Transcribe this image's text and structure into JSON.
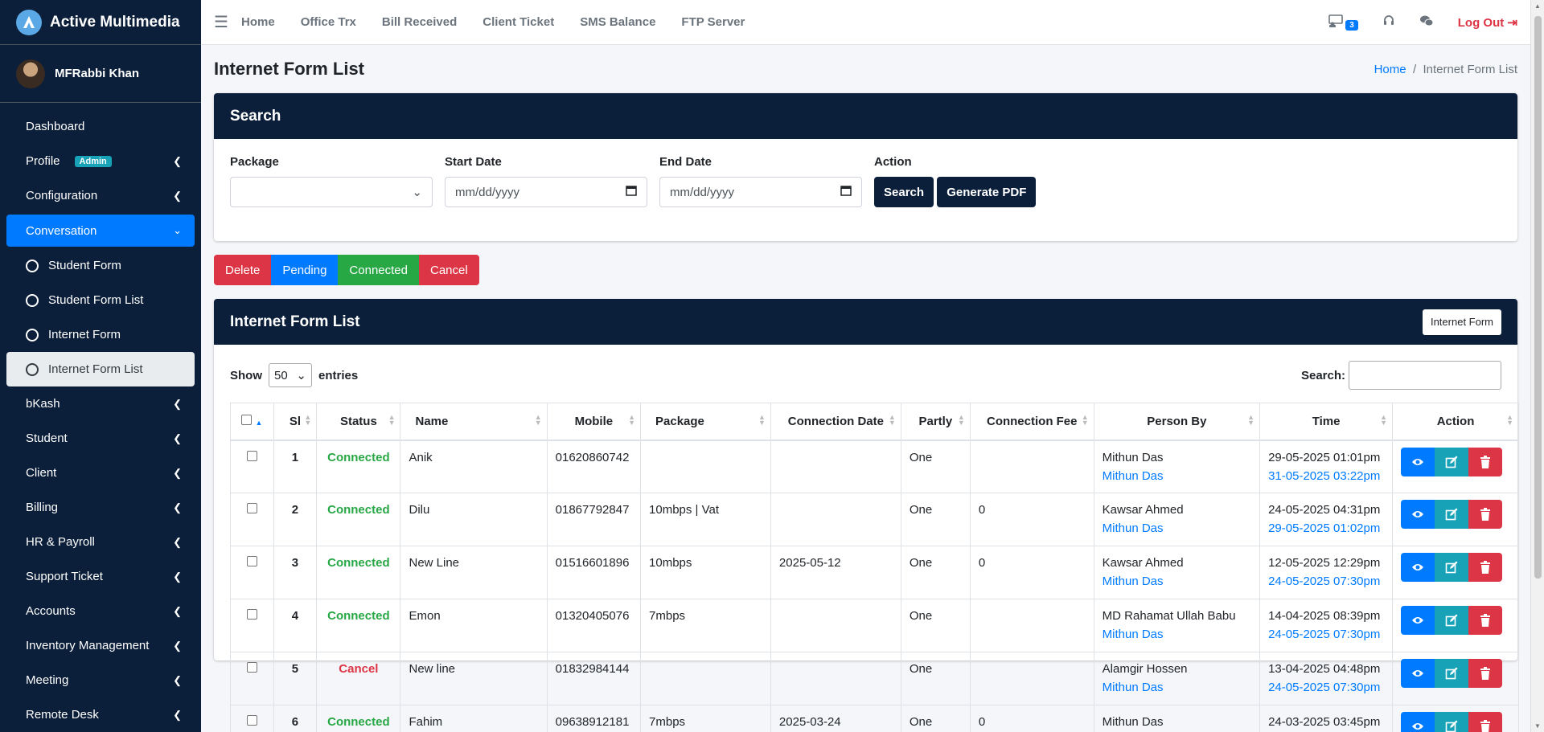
{
  "brand": {
    "name": "Active Multimedia"
  },
  "user": {
    "name": "MFRabbi Khan"
  },
  "sidebar": {
    "items": [
      {
        "label": "Dashboard"
      },
      {
        "label": "Profile",
        "badge": "Admin"
      },
      {
        "label": "Configuration"
      },
      {
        "label": "Conversation"
      },
      {
        "label": "Student Form"
      },
      {
        "label": "Student Form List"
      },
      {
        "label": "Internet Form"
      },
      {
        "label": "Internet Form List"
      },
      {
        "label": "bKash"
      },
      {
        "label": "Student"
      },
      {
        "label": "Client"
      },
      {
        "label": "Billing"
      },
      {
        "label": "HR & Payroll"
      },
      {
        "label": "Support Ticket"
      },
      {
        "label": "Accounts"
      },
      {
        "label": "Inventory Management"
      },
      {
        "label": "Meeting"
      },
      {
        "label": "Remote Desk"
      }
    ]
  },
  "topnav": {
    "links": [
      "Home",
      "Office Trx",
      "Bill Received",
      "Client Ticket",
      "SMS Balance",
      "FTP Server"
    ],
    "notification_count": "3",
    "logout": "Log Out"
  },
  "page": {
    "title": "Internet Form List",
    "breadcrumb_home": "Home",
    "breadcrumb_sep": "/",
    "breadcrumb_current": "Internet Form List"
  },
  "search": {
    "header": "Search",
    "package_label": "Package",
    "start_date_label": "Start Date",
    "start_date_placeholder": "mm/dd/yyyy",
    "end_date_label": "End Date",
    "end_date_placeholder": "mm/dd/yyyy",
    "action_label": "Action",
    "search_button": "Search",
    "pdf_button": "Generate PDF"
  },
  "status_buttons": {
    "delete": "Delete",
    "pending": "Pending",
    "connected": "Connected",
    "cancel": "Cancel"
  },
  "list": {
    "header": "Internet Form List",
    "internet_form_button": "Internet Form",
    "show": "Show",
    "entries_value": "50",
    "entries": "entries",
    "search_label": "Search:",
    "columns": [
      "Sl",
      "Status",
      "Name",
      "Mobile",
      "Package",
      "Connection Date",
      "Partly",
      "Connection Fee",
      "Person By",
      "Time",
      "Action"
    ],
    "rows": [
      {
        "sl": "1",
        "status": "Connected",
        "name": "Anik",
        "mobile": "01620860742",
        "package": "",
        "conn_date": "",
        "partly": "One",
        "fee": "",
        "person": "Mithun Das",
        "person2": "Mithun Das",
        "time": "29-05-2025 01:01pm",
        "time2": "31-05-2025 03:22pm"
      },
      {
        "sl": "2",
        "status": "Connected",
        "name": "Dilu",
        "mobile": "01867792847",
        "package": "10mbps | Vat",
        "conn_date": "",
        "partly": "One",
        "fee": "0",
        "person": "Kawsar Ahmed",
        "person2": "Mithun Das",
        "time": "24-05-2025 04:31pm",
        "time2": "29-05-2025 01:02pm"
      },
      {
        "sl": "3",
        "status": "Connected",
        "name": "New Line",
        "mobile": "01516601896",
        "package": "10mbps",
        "conn_date": "2025-05-12",
        "partly": "One",
        "fee": "0",
        "person": "Kawsar Ahmed",
        "person2": "Mithun Das",
        "time": "12-05-2025 12:29pm",
        "time2": "24-05-2025 07:30pm"
      },
      {
        "sl": "4",
        "status": "Connected",
        "name": "Emon",
        "mobile": "01320405076",
        "package": "7mbps",
        "conn_date": "",
        "partly": "One",
        "fee": "",
        "person": "MD Rahamat Ullah Babu",
        "person2": "Mithun Das",
        "time": "14-04-2025 08:39pm",
        "time2": "24-05-2025 07:30pm"
      },
      {
        "sl": "5",
        "status": "Cancel",
        "name": "New line",
        "mobile": "01832984144",
        "package": "",
        "conn_date": "",
        "partly": "One",
        "fee": "",
        "person": "Alamgir Hossen",
        "person2": "Mithun Das",
        "time": "13-04-2025 04:48pm",
        "time2": "24-05-2025 07:30pm"
      },
      {
        "sl": "6",
        "status": "Connected",
        "name": "Fahim",
        "mobile": "09638912181",
        "package": "7mbps",
        "conn_date": "2025-03-24",
        "partly": "One",
        "fee": "0",
        "person": "Mithun Das",
        "person2": "",
        "time": "24-03-2025 03:45pm",
        "time2": ""
      }
    ]
  },
  "colors": {
    "navy": "#0b1f3a",
    "primary": "#007bff",
    "success": "#28a745",
    "danger": "#dc3545",
    "info": "#17a2b8"
  }
}
